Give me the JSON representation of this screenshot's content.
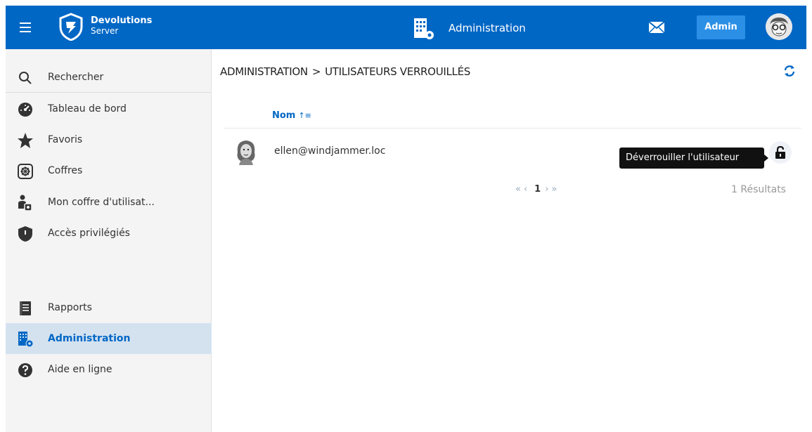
{
  "header": {
    "logo_line1": "Devolutions",
    "logo_line2": "Server",
    "title": "Administration",
    "admin_button": "Admin"
  },
  "sidebar": {
    "items": [
      {
        "label": "Rechercher",
        "icon": "search-icon"
      },
      {
        "label": "Tableau de bord",
        "icon": "dashboard-icon"
      },
      {
        "label": "Favoris",
        "icon": "star-icon"
      },
      {
        "label": "Coffres",
        "icon": "vault-icon"
      },
      {
        "label": "Mon coffre d'utilisat...",
        "icon": "user-vault-icon"
      },
      {
        "label": "Accès privilégiés",
        "icon": "shield-icon"
      },
      {
        "label": "Rapports",
        "icon": "reports-icon"
      },
      {
        "label": "Administration",
        "icon": "admin-building-icon",
        "active": true
      },
      {
        "label": "Aide en ligne",
        "icon": "help-icon"
      }
    ]
  },
  "main": {
    "breadcrumb_root": "ADMINISTRATION",
    "breadcrumb_separator": ">",
    "breadcrumb_page": "UTILISATEURS VERROUILLÉS",
    "column_header": "Nom",
    "rows": [
      {
        "email": "ellen@windjammer.loc"
      }
    ],
    "tooltip": "Déverrouiller l'utilisateur",
    "pager": {
      "first": "«",
      "prev": "‹",
      "current": "1",
      "next": "›",
      "last": "»"
    },
    "results": "1 Résultats"
  },
  "colors": {
    "brand": "#0067c5",
    "admin_button": "#2b8fe6",
    "active_bg": "#d4e2f0"
  }
}
